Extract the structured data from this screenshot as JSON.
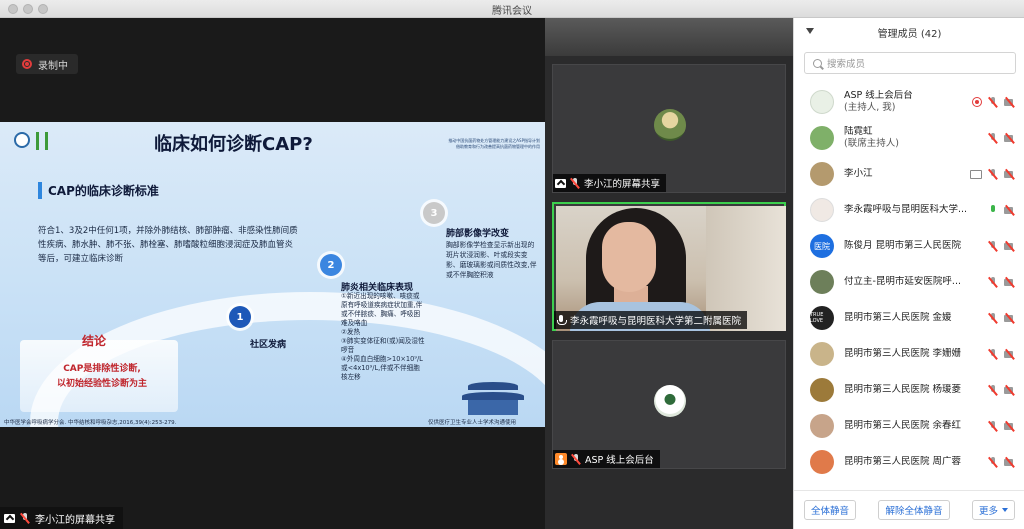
{
  "window": {
    "title": "腾讯会议"
  },
  "recording": {
    "label": "录制中",
    "accent": "#e23c3c"
  },
  "slide": {
    "title": "临床如何诊断CAP?",
    "project_line1": "推动中国抗菌药物处方管理能力建设之ASP指导计划",
    "project_line2": "借助教育和行为改善提高抗菌药物管理中的作用",
    "section": "CAP的临床诊断标准",
    "criteria_text": "符合1、3及2中任何1项，并除外肺结核、肺部肿瘤、非感染性肺间质性疾病、肺水肿、肺不张、肺栓塞、肺嗜酸粒细胞浸润症及肺血管炎等后，可建立临床诊断",
    "node1_num": "1",
    "node1_label": "社区发病",
    "node2_num": "2",
    "node2_label": "肺炎相关临床表现",
    "node2_items": [
      "①新近出现的咳嗽、咳痰或原有呼吸道疾病症状加重,伴或不伴脓痰、胸痛、呼吸困难及咯血",
      "②发热",
      "③肺实变体征和(或)闻及湿性啰音",
      "④外周血白细胞>10×10⁹/L或<4x10⁹/L,伴或不伴细胞核左移"
    ],
    "node3_num": "3",
    "node3_label": "肺部影像学改变",
    "node3_text": "胸部影像学检查显示新出现的斑片状浸润影、叶或段实变影、磨玻璃影或间质性改变,伴或不伴胸腔积液",
    "conclusion_title": "结论",
    "conclusion_line1": "CAP是排除性诊断,",
    "conclusion_line2": "以初始经验性诊断为主",
    "footnote": "中华医学会呼吸病学分会. 中华结核和呼吸杂志,2016,39(4):253-279.",
    "footnote_right": "仅供医疗卫生专业人士学术沟通使用"
  },
  "main_share_tag": {
    "label": "李小江的屏幕共享"
  },
  "gallery": {
    "tiles": [
      {
        "name": "李小江的屏幕共享"
      },
      {
        "name": "李永霞呼吸与昆明医科大学第二附属医院"
      },
      {
        "name": "ASP 线上会后台"
      }
    ]
  },
  "panel": {
    "title": "管理成员 (42)",
    "search_placeholder": "搜索成员",
    "members": [
      {
        "name": "ASP 线上会后台",
        "sub": "(主持人, 我)",
        "avatar_color": "#e9f0e6"
      },
      {
        "name": "陆霓虹",
        "sub": "(联席主持人)",
        "avatar_color": "#7fb069"
      },
      {
        "name": "李小江",
        "sub": "",
        "avatar_color": "#b49a6e"
      },
      {
        "name": "李永霞呼吸与昆明医科大学...",
        "sub": "",
        "avatar_color": "#f0e9e4"
      },
      {
        "name": "陈俊月 昆明市第三人民医院",
        "sub": "",
        "avatar_text": "医院",
        "avatar_color": "#1e6fe0"
      },
      {
        "name": "付立主-昆明市延安医院呼...",
        "sub": "",
        "avatar_color": "#6d7f5a"
      },
      {
        "name": "昆明市第三人民医院 金媛",
        "sub": "",
        "avatar_text": "TRUE LOVE",
        "avatar_color": "#222222"
      },
      {
        "name": "昆明市第三人民医院 李姗姗",
        "sub": "",
        "avatar_color": "#c9b48a"
      },
      {
        "name": "昆明市第三人民医院 杨瑗菱",
        "sub": "",
        "avatar_color": "#9c7a3a"
      },
      {
        "name": "昆明市第三人民医院 余春红",
        "sub": "",
        "avatar_color": "#c7a48a"
      },
      {
        "name": "昆明市第三人民医院 周广蓉",
        "sub": "",
        "avatar_color": "#e07a4a"
      }
    ],
    "buttons": {
      "mute_all": "全体静音",
      "unmute_all": "解除全体静音",
      "more": "更多"
    }
  }
}
